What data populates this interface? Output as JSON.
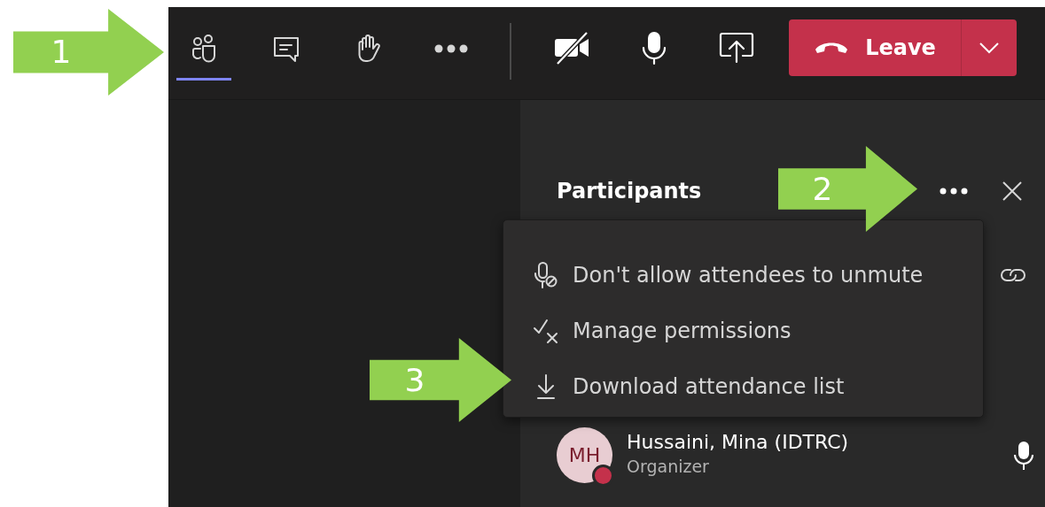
{
  "toolbar": {
    "tabs": [
      {
        "kind": "people",
        "selected": true
      },
      {
        "kind": "chat",
        "selected": false
      },
      {
        "kind": "hand",
        "selected": false
      },
      {
        "kind": "more",
        "selected": false
      }
    ],
    "controls": [
      {
        "kind": "camera",
        "on": false
      },
      {
        "kind": "mic",
        "on": true
      },
      {
        "kind": "share"
      }
    ],
    "leave_button": {
      "label": "Leave"
    }
  },
  "participants_panel": {
    "title": "Participants",
    "menu": [
      {
        "kind": "mute",
        "label": "Don't allow attendees to unmute"
      },
      {
        "kind": "permissions",
        "label": "Manage permissions"
      },
      {
        "kind": "download",
        "label": "Download attendance list"
      }
    ],
    "participants": [
      {
        "initials": "MH",
        "name": "Hussaini, Mina (IDTRC)",
        "role": "Organizer",
        "color": "#c4314b",
        "mic_on": true
      }
    ]
  },
  "annotations": [
    {
      "label": "1"
    },
    {
      "label": "2"
    },
    {
      "label": "3"
    }
  ]
}
